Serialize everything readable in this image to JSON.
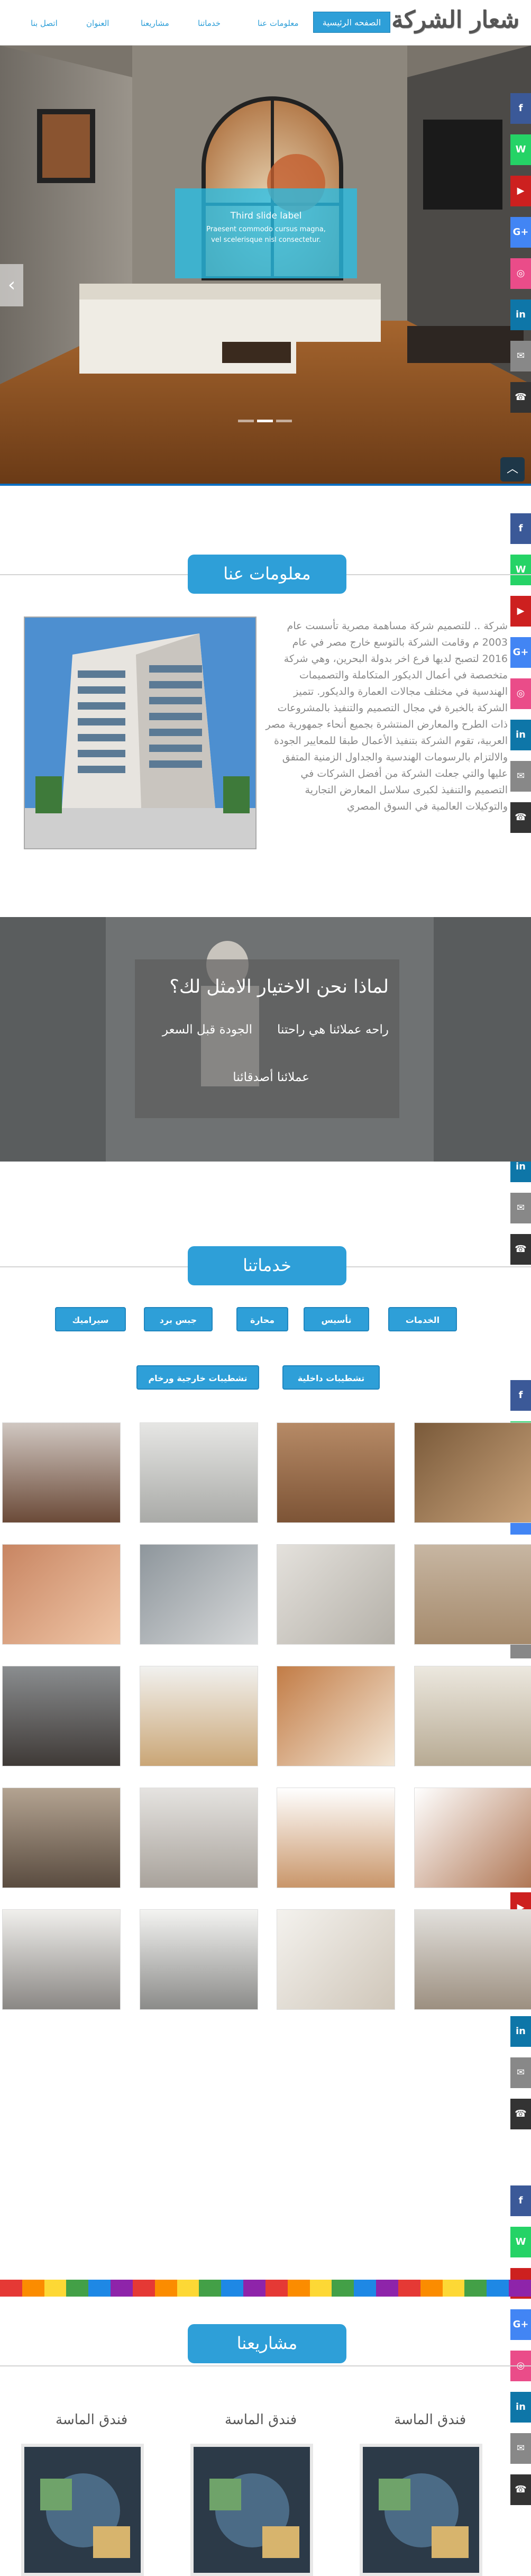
{
  "header": {
    "logo": "شعار الشركة",
    "nav": [
      "الصفحه الرئيسية",
      "معلومات عنا",
      "خدماتنا",
      "مشاريعنا",
      "العنوان",
      "اتصل بنا"
    ]
  },
  "hero": {
    "caption_title": "Third slide label",
    "caption_line1": "Praesent commodo cursus magna,",
    "caption_line2": "vel scelerisque nisl consectetur.",
    "slide_count": 3,
    "active_slide": 1
  },
  "social": {
    "buttons": [
      "f",
      "W",
      "▶",
      "G+",
      "◎",
      "in",
      "✉",
      "☎"
    ],
    "colors": [
      "#3b5998",
      "#25d366",
      "#cd201f",
      "#4285f4",
      "#ea4c89",
      "#0e76a8",
      "#888888",
      "#333333"
    ]
  },
  "about": {
    "title": "معلومات عنا",
    "text": "شركة .. للتصميم شركة مساهمة مصرية تأسست عام 2003 م وقامت الشركة بالتوسع خارج مصر في عام 2016 لتصبح لديها فرع اخر بدولة البحرين، وهي شركة متخصصة في أعمال الديكور المتكاملة والتصميمات الهندسية في مختلف مجالات العمارة والديكور. تتميز الشركة بالخبرة في مجال التصميم والتنفيذ بالمشروعات ذات الطرح والمعارض المنتشرة بجميع أنحاء جمهورية مصر العربية، تقوم الشركة بتنفيذ الأعمال طبقا للمعايير الجودة والالتزام بالرسومات الهندسية والجداول الزمنية المتفق عليها والتي جعلت الشركة من أفضل الشركات في التصميم والتنفيذ لكبرى سلاسل المعارض التجارية والتوكيلات العالمية في السوق المصري"
  },
  "why": {
    "title": "لماذا نحن الاختيار الامثل لك؟",
    "point1": "راحه عملائنا هي راحتنا",
    "point2": "الجودة قبل السعر",
    "point3": "عملائنا أصدقائنا"
  },
  "services": {
    "title": "خدماتنا",
    "filters": [
      "الخدمات",
      "تأسيس",
      "محارة",
      "جبس برد",
      "سيراميك",
      "تشطيبات داخلية",
      "تشطيبات خارجية ورخام"
    ]
  },
  "projects": {
    "title": "مشاريعنا",
    "items": [
      "فندق الماسة",
      "فندق الماسة",
      "فندق الماسة"
    ]
  }
}
